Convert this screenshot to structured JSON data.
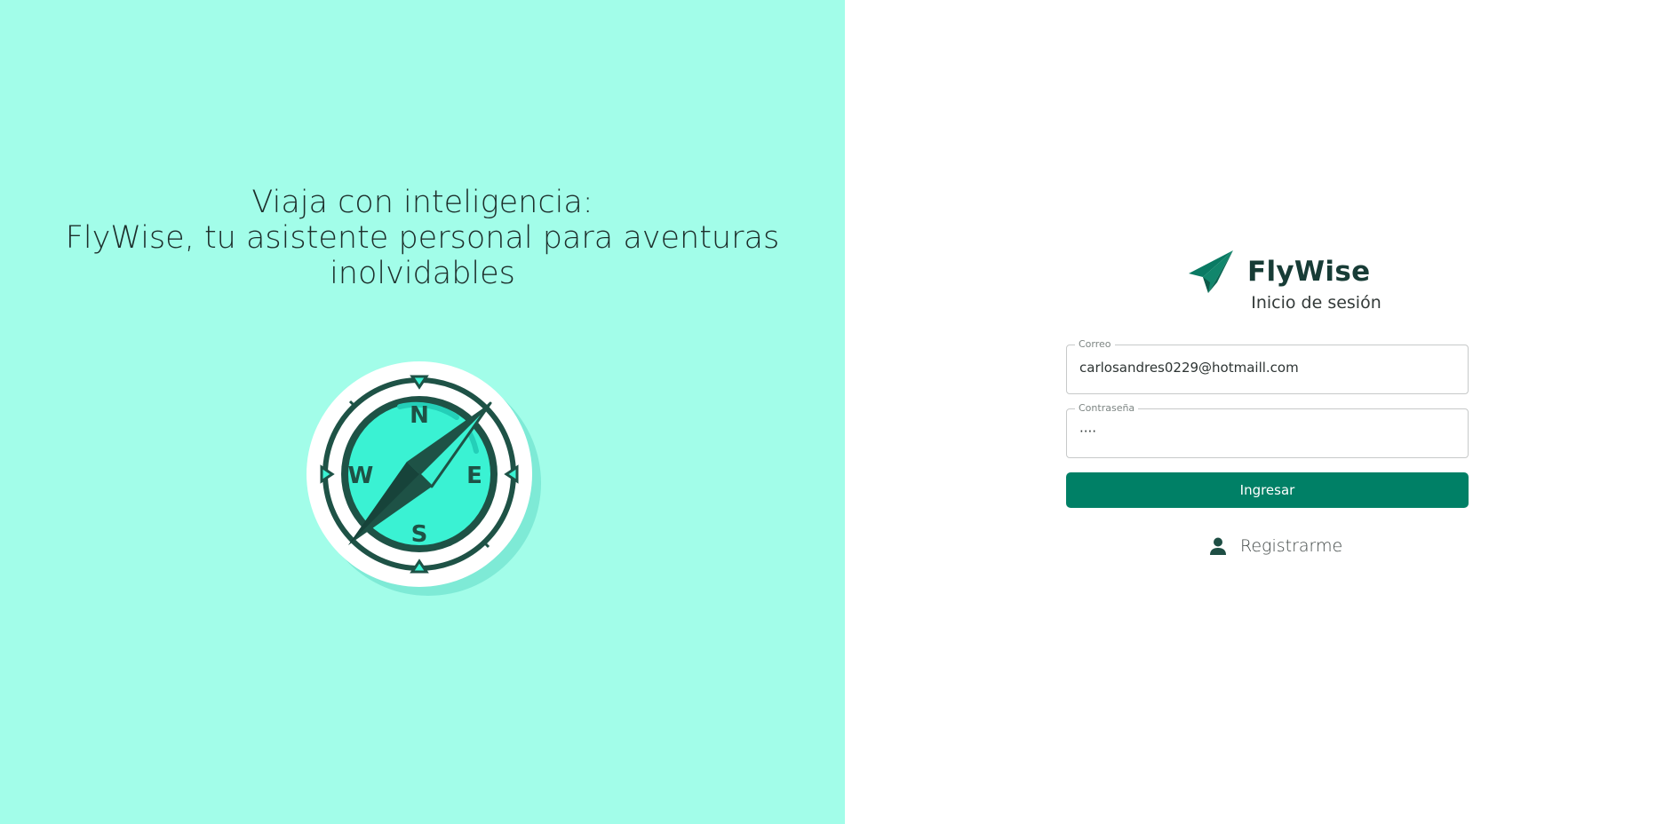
{
  "hero": {
    "tagline_line1": "Viaja con inteligencia:",
    "tagline_line2": "FlyWise, tu asistente personal para aventuras",
    "tagline_line3": "inolvidables",
    "compass_labels": {
      "n": "N",
      "s": "S",
      "e": "E",
      "w": "W"
    }
  },
  "login": {
    "brand_name": "FlyWise",
    "subtitle": "Inicio de sesión",
    "email": {
      "label": "Correo",
      "value": "carlosandres0229@hotmaill.com"
    },
    "password": {
      "label": "Contraseña",
      "value": "····"
    },
    "submit_label": "Ingresar",
    "register_label": "Registrarme"
  },
  "icons": {
    "brand_logo": "paper-plane-icon",
    "compass": "compass-icon",
    "register": "user-icon"
  },
  "colors": {
    "left_background": "#a2fde9",
    "primary": "#008066",
    "brand_text": "#173c36",
    "compass_dark": "#1e5246",
    "compass_face": "#3af2d3"
  }
}
